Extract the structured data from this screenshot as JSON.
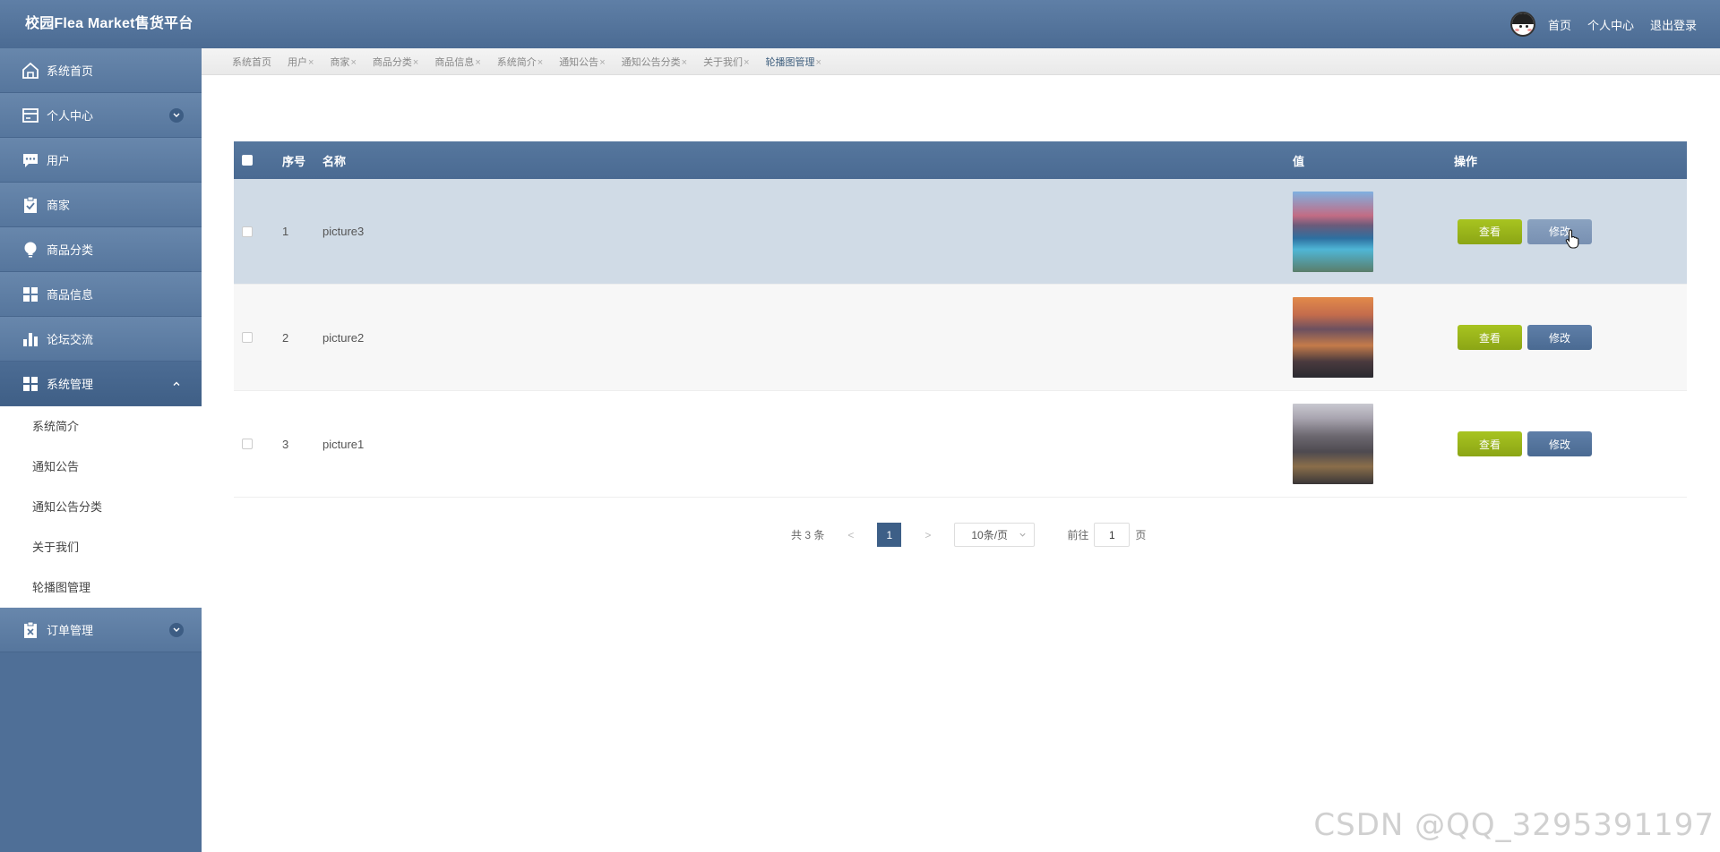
{
  "header": {
    "title": "校园Flea Market售货平台",
    "links": [
      "首页",
      "个人中心",
      "退出登录"
    ]
  },
  "sidebar": {
    "items": [
      {
        "label": "系统首页",
        "icon": "home-icon"
      },
      {
        "label": "个人中心",
        "icon": "card-icon",
        "expandable": true
      },
      {
        "label": "用户",
        "icon": "chat-icon"
      },
      {
        "label": "商家",
        "icon": "clipboard-check-icon"
      },
      {
        "label": "商品分类",
        "icon": "bulb-icon"
      },
      {
        "label": "商品信息",
        "icon": "grid-icon"
      },
      {
        "label": "论坛交流",
        "icon": "bar-chart-icon"
      },
      {
        "label": "系统管理",
        "icon": "grid-icon",
        "expanded": true
      },
      {
        "label": "订单管理",
        "icon": "clipboard-x-icon",
        "expandable": true
      }
    ],
    "submenu": [
      "系统简介",
      "通知公告",
      "通知公告分类",
      "关于我们",
      "轮播图管理"
    ]
  },
  "tabs": [
    {
      "label": "系统首页",
      "closable": false
    },
    {
      "label": "用户",
      "closable": true
    },
    {
      "label": "商家",
      "closable": true
    },
    {
      "label": "商品分类",
      "closable": true
    },
    {
      "label": "商品信息",
      "closable": true
    },
    {
      "label": "系统简介",
      "closable": true
    },
    {
      "label": "通知公告",
      "closable": true
    },
    {
      "label": "通知公告分类",
      "closable": true
    },
    {
      "label": "关于我们",
      "closable": true
    },
    {
      "label": "轮播图管理",
      "closable": true,
      "active": true
    }
  ],
  "table": {
    "columns": {
      "index": "序号",
      "name": "名称",
      "value": "值",
      "actions": "操作"
    },
    "rows": [
      {
        "index": "1",
        "name": "picture3"
      },
      {
        "index": "2",
        "name": "picture2"
      },
      {
        "index": "3",
        "name": "picture1"
      }
    ],
    "view_label": "查看",
    "edit_label": "修改"
  },
  "pagination": {
    "total": "共 3 条",
    "prev": "<",
    "current": "1",
    "next": ">",
    "page_size": "10条/页",
    "goto_label": "前往",
    "goto_value": "1",
    "page_unit": "页"
  },
  "watermark": "CSDN @QQ_3295391197",
  "colors": {
    "header": "#56769d",
    "view_button": "#9ab51a",
    "edit_button": "#54749c"
  }
}
